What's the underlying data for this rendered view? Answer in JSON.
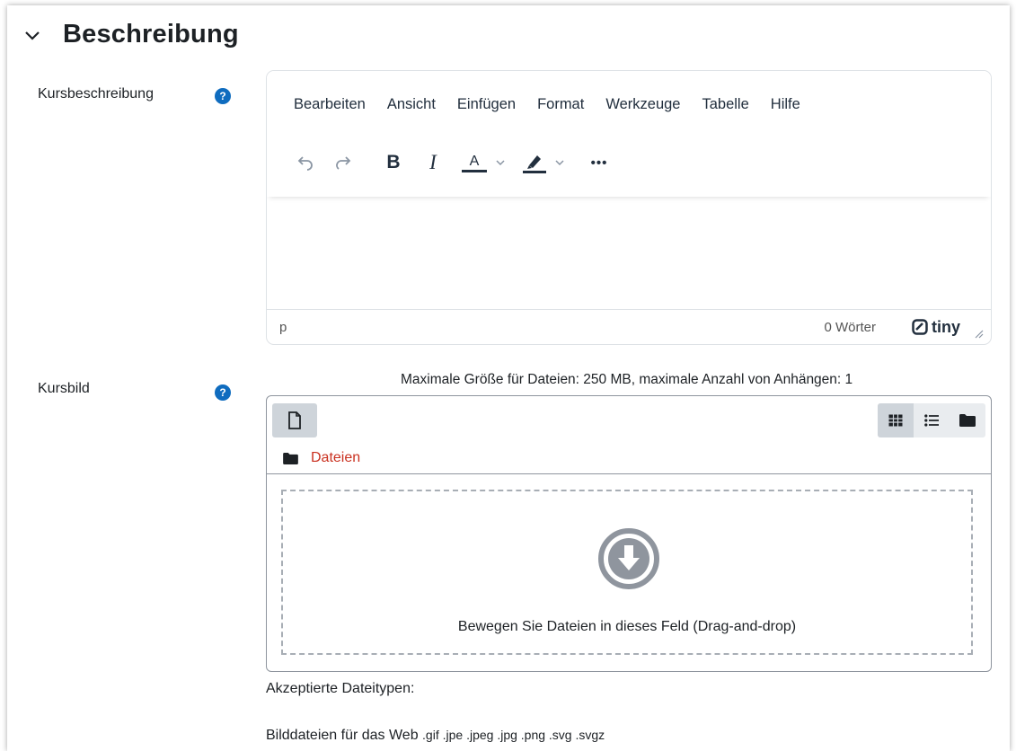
{
  "section": {
    "title": "Beschreibung",
    "collapse_icon": "chevron-down-icon"
  },
  "kursbeschreibung": {
    "label": "Kursbeschreibung",
    "help_icon": "question-circle-icon",
    "help_glyph": "?",
    "editor": {
      "menu": [
        "Bearbeiten",
        "Ansicht",
        "Einfügen",
        "Format",
        "Werkzeuge",
        "Tabelle",
        "Hilfe"
      ],
      "toolbar": {
        "undo": "undo-icon",
        "redo": "redo-icon",
        "bold": "B",
        "italic": "I",
        "text_color": "A",
        "highlight": "highlight-icon",
        "more": "•••"
      },
      "status": {
        "path": "p",
        "word_count": "0 Wörter",
        "brand": "tiny"
      }
    }
  },
  "kursbild": {
    "label": "Kursbild",
    "help_icon": "question-circle-icon",
    "help_glyph": "?",
    "limits": "Maximale Größe für Dateien: 250 MB, maximale Anzahl von Anhängen: 1",
    "filemanager": {
      "add_icon": "file-icon",
      "views": [
        "grid-icon",
        "list-icon",
        "folder-icon"
      ],
      "path_icon": "folder-icon",
      "path_label": "Dateien",
      "drop_icon": "download-circle-icon",
      "drop_text": "Bewegen Sie Dateien in dieses Feld (Drag-and-drop)"
    },
    "accepted": {
      "title": "Akzeptierte Dateitypen:",
      "types_label": "Bilddateien für das Web",
      "extensions": ".gif .jpe .jpeg .jpg .png .svg .svgz"
    }
  },
  "colors": {
    "help_icon": "#0f6cbf",
    "path_link": "#ca3120",
    "toolbar_icon": "#8a95a3"
  }
}
